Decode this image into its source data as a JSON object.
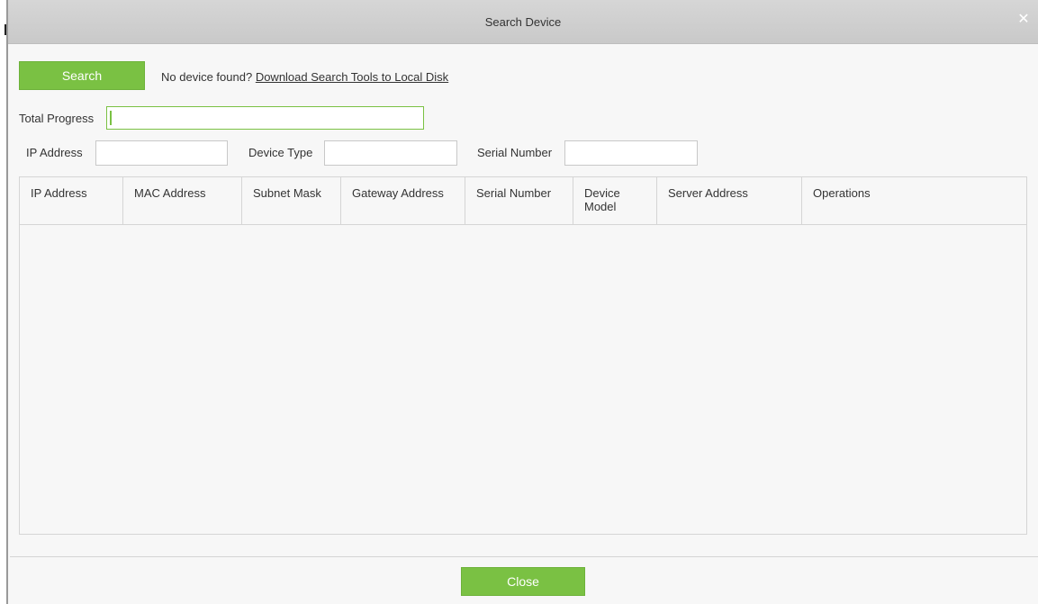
{
  "dialog": {
    "title": "Search Device",
    "close_icon": "close-icon"
  },
  "toolbar": {
    "search_label": "Search",
    "notice_text": "No device found?",
    "download_link": "Download Search Tools to Local Disk"
  },
  "progress": {
    "label": "Total Progress",
    "value_percent": 0
  },
  "filters": {
    "ip_label": "IP Address",
    "ip_value": "",
    "device_type_label": "Device Type",
    "device_type_value": "",
    "serial_label": "Serial Number",
    "serial_value": ""
  },
  "table": {
    "columns": [
      "IP Address",
      "MAC Address",
      "Subnet Mask",
      "Gateway Address",
      "Serial Number",
      "Device Model",
      "Server Address",
      "Operations"
    ],
    "rows": []
  },
  "footer": {
    "close_label": "Close"
  },
  "colors": {
    "accent": "#7ac143",
    "titlebar": "#cecece"
  }
}
